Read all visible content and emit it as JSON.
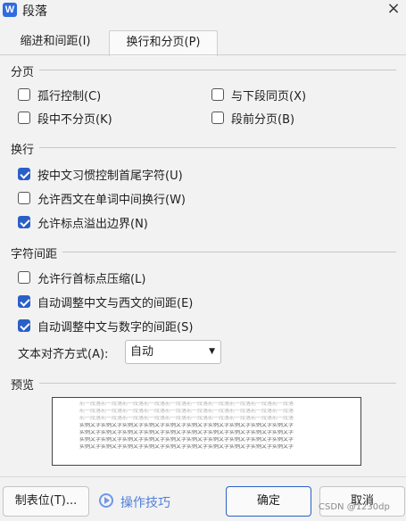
{
  "window": {
    "app_icon_letter": "W",
    "title": "段落",
    "close_glyph": "×"
  },
  "tabs": [
    {
      "label": "缩进和间距(I)",
      "selected": false
    },
    {
      "label": "换行和分页(P)",
      "selected": true
    }
  ],
  "pagination": {
    "header": "分页",
    "widow_control": {
      "label": "孤行控制(C)",
      "checked": false
    },
    "keep_with_next": {
      "label": "与下段同页(X)",
      "checked": false
    },
    "keep_lines_together": {
      "label": "段中不分页(K)",
      "checked": false
    },
    "page_break_before": {
      "label": "段前分页(B)",
      "checked": false
    }
  },
  "line_break": {
    "header": "换行",
    "chinese_rules": {
      "label": "按中文习惯控制首尾字符(U)",
      "checked": true
    },
    "allow_latin_wrap": {
      "label": "允许西文在单词中间换行(W)",
      "checked": false
    },
    "allow_punct_overflow": {
      "label": "允许标点溢出边界(N)",
      "checked": true
    }
  },
  "char_spacing": {
    "header": "字符间距",
    "compress_punct": {
      "label": "允许行首标点压缩(L)",
      "checked": false
    },
    "auto_cn_latin": {
      "label": "自动调整中文与西文的间距(E)",
      "checked": true
    },
    "auto_cn_digit": {
      "label": "自动调整中文与数字的间距(S)",
      "checked": true
    }
  },
  "text_alignment": {
    "label": "文本对齐方式(A):",
    "selected": "自动"
  },
  "preview": {
    "header": "预览",
    "gray_line": "前一段落前一段落前一段落前一段落前一段落前一段落前一段落前一段落前一段落前一段落",
    "dark_line": "实例文字实例文字实例文字实例文字实例文字实例文字实例文字实例文字实例文字实例文字"
  },
  "buttons": {
    "tab_stops": "制表位(T)...",
    "tips": "操作技巧",
    "ok": "确定",
    "cancel": "取消"
  },
  "watermark": "CSDN @1230dp",
  "colors": {
    "accent": "#2a5fc7",
    "tips": "#4f7fd9"
  }
}
